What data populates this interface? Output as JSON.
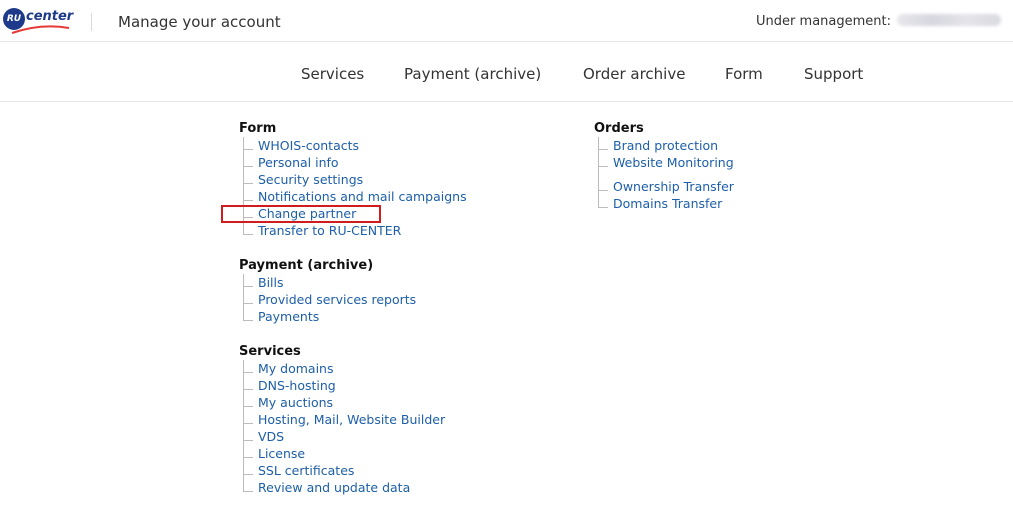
{
  "header": {
    "logo_ru": "RU",
    "logo_center": "center",
    "title": "Manage your account",
    "management_label": "Under management:"
  },
  "nav": [
    "Services",
    "Payment (archive)",
    "Order archive",
    "Form",
    "Support"
  ],
  "sections": {
    "form": {
      "title": "Form",
      "items": [
        "WHOIS-contacts",
        "Personal info",
        "Security settings",
        "Notifications and mail campaigns",
        "Change partner",
        "Transfer to RU-CENTER"
      ]
    },
    "payment": {
      "title": "Payment (archive)",
      "items": [
        "Bills",
        "Provided services reports",
        "Payments"
      ]
    },
    "services": {
      "title": "Services",
      "items": [
        "My domains",
        "DNS-hosting",
        "My auctions",
        "Hosting, Mail, Website Builder",
        "VDS",
        "License",
        "SSL certificates",
        "Review and update data"
      ]
    },
    "orders": {
      "title": "Orders",
      "items": [
        "Brand protection",
        "Website Monitoring",
        "Ownership Transfer",
        "Domains Transfer"
      ]
    }
  },
  "colors": {
    "link": "#1d5fa8",
    "highlight": "#d01c1c",
    "brand": "#1e3a8a",
    "brand_swoosh": "#e53935"
  }
}
